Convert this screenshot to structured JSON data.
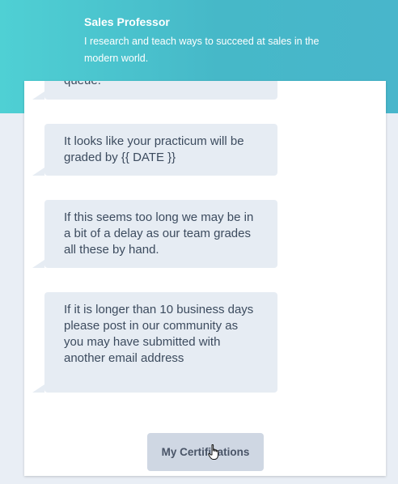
{
  "header": {
    "title": "Sales Professor",
    "description": "I research and teach ways to succeed at sales in the modern world."
  },
  "messages": [
    "queue.",
    "It looks like your practicum will be graded by {{ DATE }}",
    "If this seems too long we may be in a bit of a delay as our team grades all these by hand.",
    "If it is longer than 10 business days please post in our community as you may have submitted with another email address"
  ],
  "action_button": {
    "label": "My Certifications"
  },
  "icons": {
    "cursor": "hand-pointer-icon"
  },
  "colors": {
    "header_start": "#4fd0d4",
    "header_end": "#48b6cb",
    "bubble": "#e6ecf3",
    "button": "#cfd7e3",
    "text": "#3c4b5e"
  }
}
